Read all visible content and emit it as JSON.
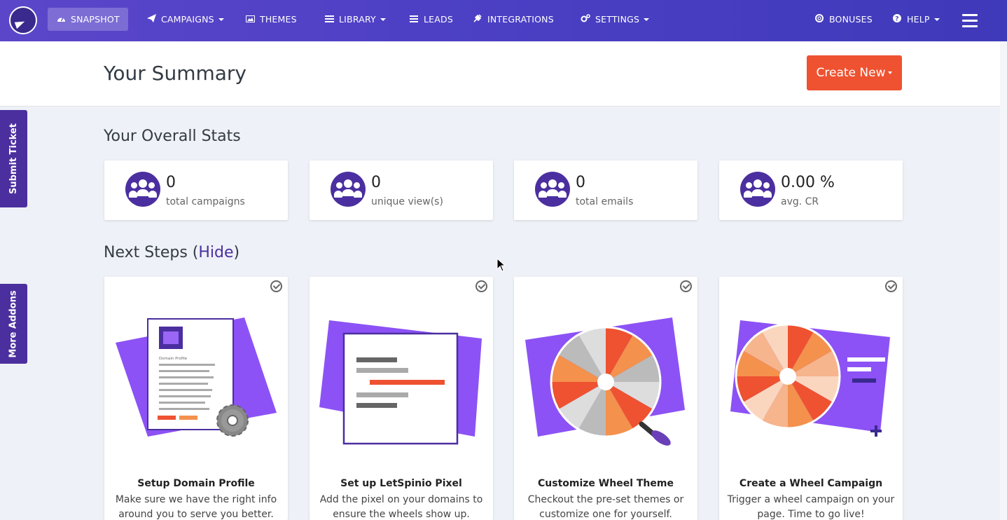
{
  "nav": {
    "items": [
      {
        "label": "SNAPSHOT",
        "icon": "dashboard-icon",
        "active": true
      },
      {
        "label": "CAMPAIGNS",
        "icon": "paper-plane-icon",
        "dropdown": true
      },
      {
        "label": "THEMES",
        "icon": "image-icon"
      },
      {
        "label": "LIBRARY",
        "icon": "library-icon",
        "dropdown": true
      },
      {
        "label": "LEADS",
        "icon": "list-icon"
      },
      {
        "label": "INTEGRATIONS",
        "icon": "plug-icon"
      },
      {
        "label": "SETTINGS",
        "icon": "cogs-icon",
        "dropdown": true
      },
      {
        "label": "BONUSES",
        "icon": "lifebuoy-icon"
      },
      {
        "label": "HELP",
        "icon": "question-icon",
        "dropdown": true
      }
    ]
  },
  "header": {
    "title": "Your Summary",
    "create_label": "Create New"
  },
  "side_tabs": {
    "submit_ticket": "Submit Ticket",
    "more_addons": "More Addons"
  },
  "stats": {
    "title": "Your Overall Stats",
    "items": [
      {
        "value": "0",
        "label": "total campaigns"
      },
      {
        "value": "0",
        "label": "unique view(s)"
      },
      {
        "value": "0",
        "label": "total emails"
      },
      {
        "value": "0.00 %",
        "label": "avg. CR"
      }
    ]
  },
  "next_steps": {
    "title": "Next Steps",
    "paren_open": "(",
    "hide_label": "Hide",
    "paren_close": ")",
    "cards": [
      {
        "title": "Setup Domain Profile",
        "desc": "Make sure we have the right info around you to serve you better.",
        "illus_text": "Domain Profile"
      },
      {
        "title": "Set up LetSpinio Pixel",
        "desc": "Add the pixel on your domains to ensure the wheels show up."
      },
      {
        "title": "Customize Wheel Theme",
        "desc": "Checkout the pre-set themes or customize one for yourself."
      },
      {
        "title": "Create a Wheel Campaign",
        "desc": "Trigger a wheel campaign on your page. Time to go live!"
      }
    ]
  },
  "colors": {
    "nav_gradient_start": "#5b46c9",
    "nav_gradient_end": "#3f3aba",
    "accent_orange": "#ee5231",
    "brand_purple": "#4b2fa0",
    "illus_purple": "#8c52f5"
  }
}
